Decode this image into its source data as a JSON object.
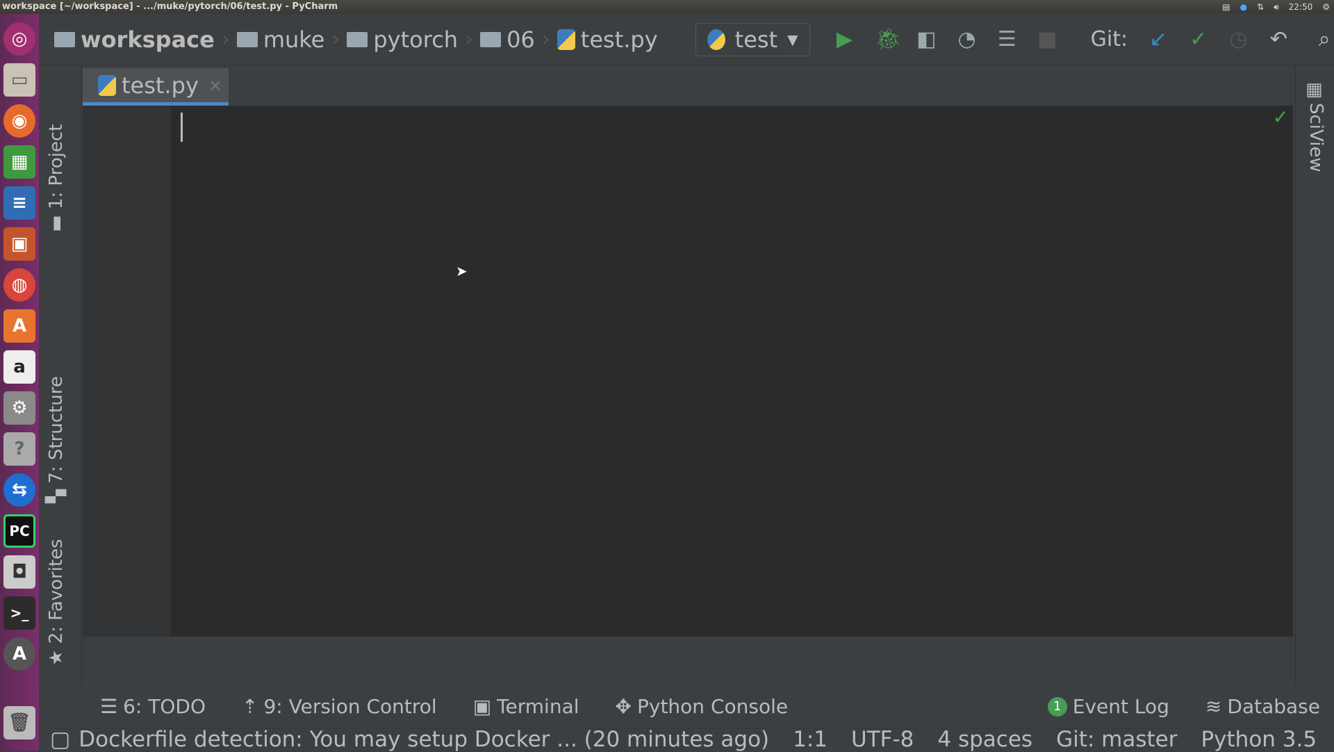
{
  "window": {
    "title": "workspace [~/workspace] - .../muke/pytorch/06/test.py - PyCharm",
    "clock": "22:50"
  },
  "breadcrumbs": [
    "workspace",
    "muke",
    "pytorch",
    "06",
    "test.py"
  ],
  "run_config": "test",
  "toolbar": {
    "git_label": "Git:"
  },
  "tabs": [
    {
      "label": "test.py",
      "close": "×"
    }
  ],
  "left_tools": [
    "1: Project",
    "7: Structure",
    "2: Favorites"
  ],
  "right_tools": [
    "SciView"
  ],
  "tool_windows": {
    "todo": "6: TODO",
    "vcs": "9: Version Control",
    "terminal": "Terminal",
    "console": "Python Console",
    "event_log": "Event Log",
    "event_count": "1",
    "database": "Database"
  },
  "status": {
    "message": "Dockerfile detection: You may setup Docker ... (20 minutes ago)",
    "position": "1:1",
    "encoding": "UTF-8",
    "indent": "4 spaces",
    "branch": "Git: master",
    "interpreter": "Python 3.5"
  },
  "colors": {
    "accent": "#4a88c7",
    "run": "#499c54",
    "launcher": "#6b2c60"
  }
}
